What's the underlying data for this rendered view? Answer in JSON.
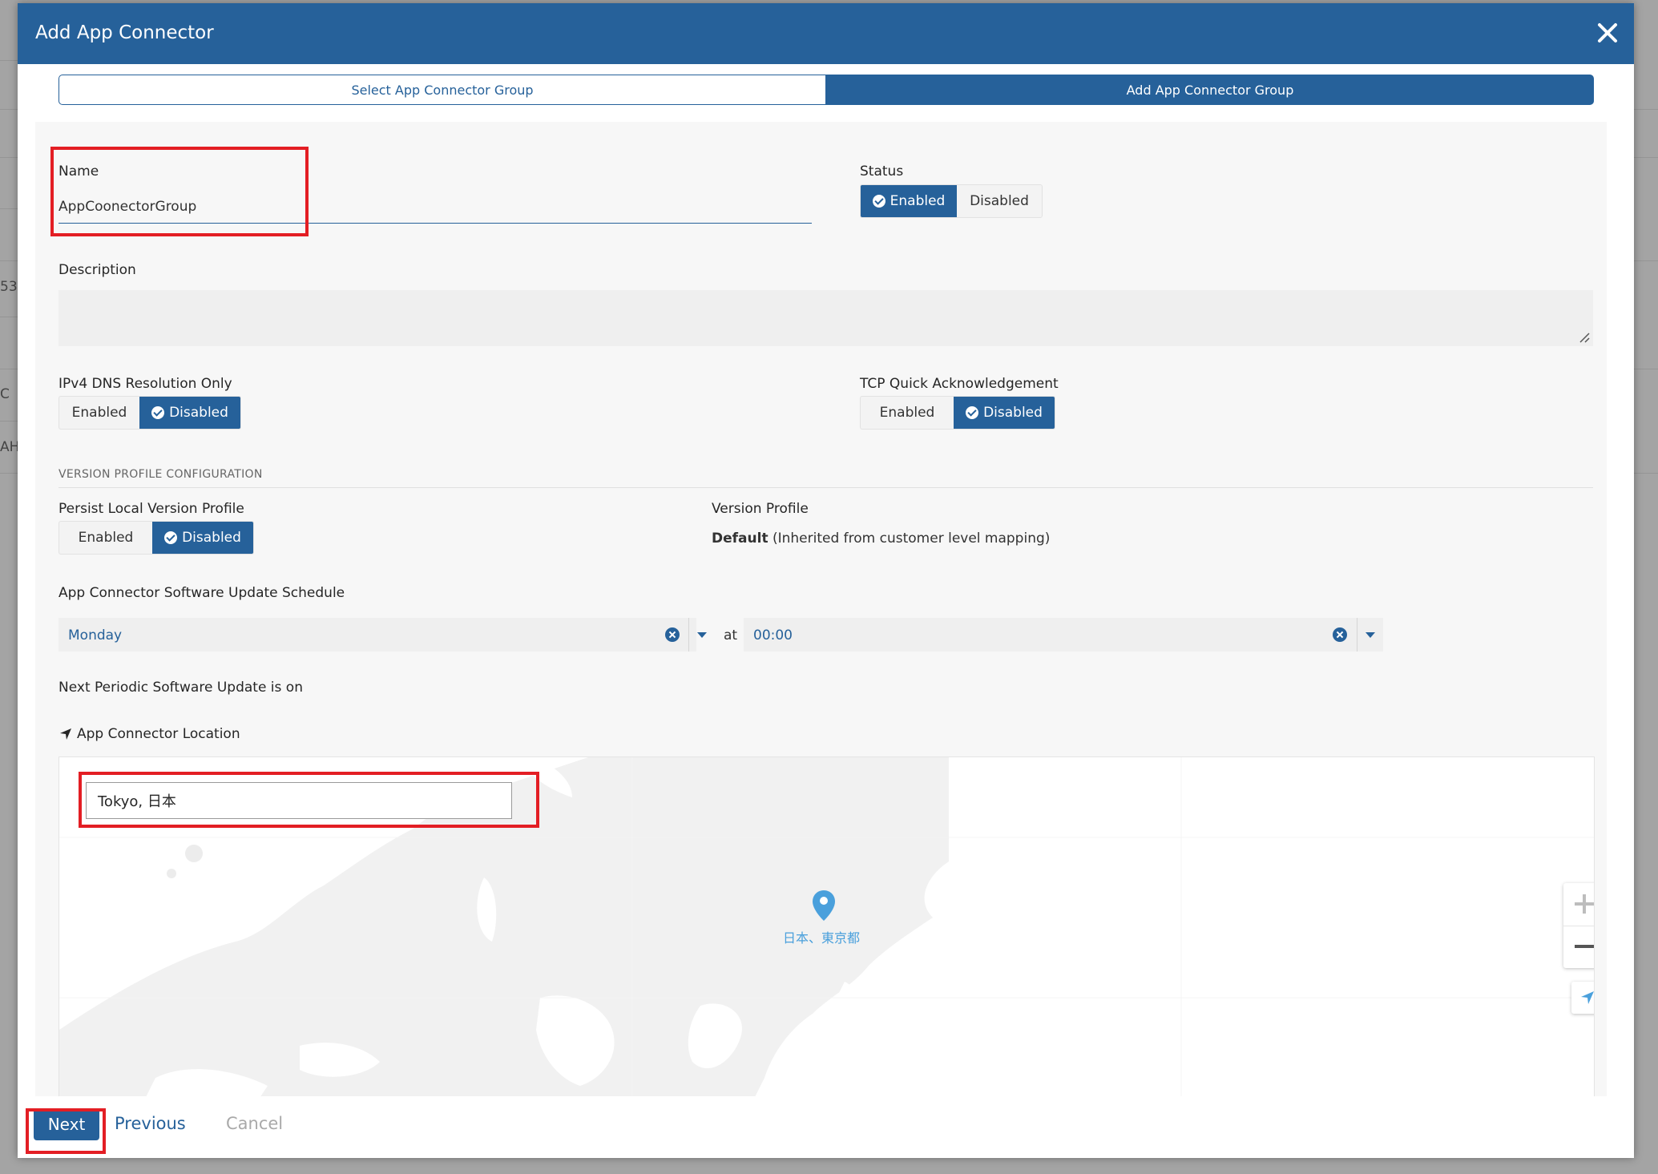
{
  "background": {
    "fragments": [
      "538",
      "C",
      "AH"
    ]
  },
  "modal": {
    "title": "Add App Connector",
    "close_icon": "close-icon"
  },
  "tabs": [
    {
      "label": "Select App Connector Group",
      "active": false
    },
    {
      "label": "Add App Connector Group",
      "active": true
    }
  ],
  "form": {
    "name": {
      "label": "Name",
      "value": "AppCoonectorGroup"
    },
    "status": {
      "label": "Status",
      "options": [
        "Enabled",
        "Disabled"
      ],
      "selected": "Enabled"
    },
    "description": {
      "label": "Description",
      "value": ""
    },
    "ipv4_dns": {
      "label": "IPv4 DNS Resolution Only",
      "options": [
        "Enabled",
        "Disabled"
      ],
      "selected": "Disabled"
    },
    "tcp_ack": {
      "label": "TCP Quick Acknowledgement",
      "options": [
        "Enabled",
        "Disabled"
      ],
      "selected": "Disabled"
    },
    "version_section": {
      "title": "VERSION PROFILE CONFIGURATION"
    },
    "persist_profile": {
      "label": "Persist Local Version Profile",
      "options": [
        "Enabled",
        "Disabled"
      ],
      "selected": "Disabled"
    },
    "version_profile": {
      "label": "Version Profile",
      "value_bold": "Default",
      "value_rest": " (Inherited from customer level mapping)"
    },
    "schedule": {
      "label": "App Connector Software Update Schedule",
      "day": "Monday",
      "at": "at",
      "time": "00:00"
    },
    "next_update": {
      "label": "Next Periodic Software Update is on",
      "value": ""
    },
    "location": {
      "label": "App Connector Location",
      "search_value": "Tokyo, 日本",
      "marker_label": "日本、東京都"
    }
  },
  "footer": {
    "next": "Next",
    "previous": "Previous",
    "cancel": "Cancel"
  },
  "colors": {
    "primary": "#26619a",
    "highlight": "#e31e24",
    "marker": "#4aa0dc"
  }
}
